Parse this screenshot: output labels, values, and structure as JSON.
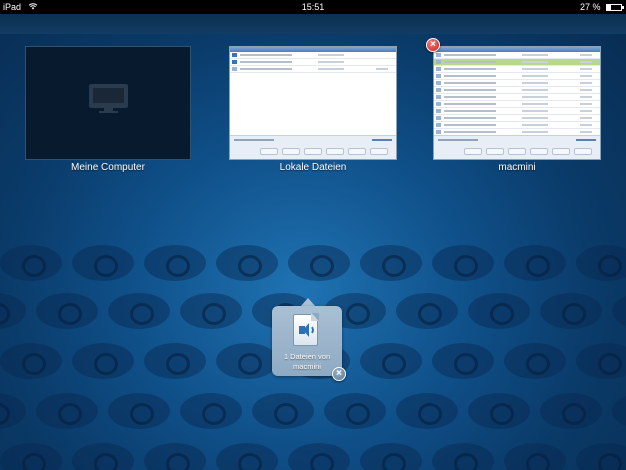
{
  "status_bar": {
    "device": "iPad",
    "time": "15:51",
    "battery": "27 %"
  },
  "thumbnails": [
    {
      "label": "Meine Computer"
    },
    {
      "label": "Lokale Dateien"
    },
    {
      "label": "macmini"
    }
  ],
  "popup": {
    "text_line1": "1 Dateien von",
    "text_line2": "macmini"
  },
  "icons": {
    "wifi": "wifi-icon",
    "battery": "battery-icon",
    "computer": "monitor-icon",
    "audio_file": "audio-file-icon",
    "close": "close-icon"
  },
  "colors": {
    "background": "#0f4f88",
    "close_red": "#c81d1d",
    "selected_row": "#b8d98b"
  }
}
